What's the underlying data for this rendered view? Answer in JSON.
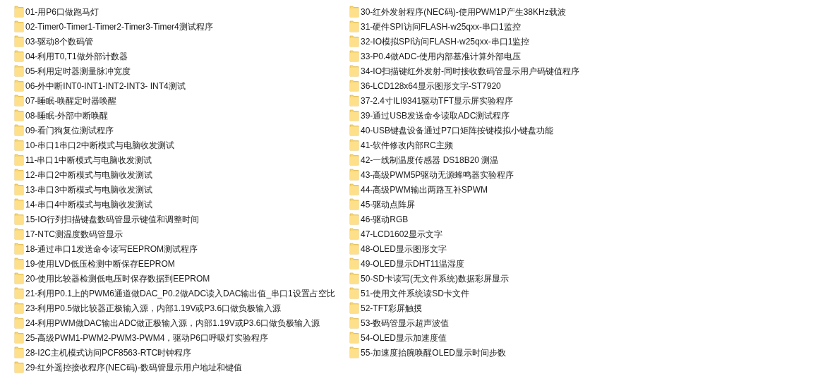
{
  "columns": [
    {
      "items": [
        {
          "name": "01-用P6口做跑马灯"
        },
        {
          "name": "02-Timer0-Timer1-Timer2-Timer3-Timer4测试程序"
        },
        {
          "name": "03-驱动8个数码管"
        },
        {
          "name": "04-利用T0,T1做外部计数器"
        },
        {
          "name": "05-利用定时器测量脉冲宽度"
        },
        {
          "name": "06-外中断INT0-INT1-INT2-INT3- INT4测试"
        },
        {
          "name": "07-睡眠-唤醒定时器唤醒"
        },
        {
          "name": "08-睡眠-外部中断唤醒"
        },
        {
          "name": "09-看门狗复位测试程序"
        },
        {
          "name": "10-串口1串口2中断模式与电脑收发测试"
        },
        {
          "name": "11-串口1中断模式与电脑收发测试"
        },
        {
          "name": "12-串口2中断模式与电脑收发测试"
        },
        {
          "name": "13-串口3中断模式与电脑收发测试"
        },
        {
          "name": "14-串口4中断模式与电脑收发测试"
        },
        {
          "name": "15-IO行列扫描键盘数码管显示键值和调整时间"
        },
        {
          "name": "17-NTC测温度数码管显示"
        },
        {
          "name": "18-通过串口1发送命令读写EEPROM测试程序"
        },
        {
          "name": "19-使用LVD低压检测中断保存EEPROM"
        },
        {
          "name": "20-使用比较器检测低电压时保存数据到EEPROM"
        },
        {
          "name": "21-利用P0.1上的PWM6通道做DAC_P0.2做ADC读入DAC输出值_串口1设置占空比"
        },
        {
          "name": "23-利用P0.5做比较器正极输入源，内部1.19V或P3.6口做负极输入源"
        },
        {
          "name": "24-利用PWM做DAC输出ADC做正极输入源，内部1.19V或P3.6口做负极输入源"
        },
        {
          "name": "25-高级PWM1-PWM2-PWM3-PWM4，驱动P6口呼吸灯实验程序"
        },
        {
          "name": "28-I2C主机模式访问PCF8563-RTC时钟程序"
        },
        {
          "name": "29-红外遥控接收程序(NEC码)-数码管显示用户地址和键值"
        }
      ]
    },
    {
      "items": [
        {
          "name": "30-红外发射程序(NEC码)-使用PWM1P产生38KHz载波"
        },
        {
          "name": "31-硬件SPI访问FLASH-w25qxx-串口1监控"
        },
        {
          "name": "32-IO模拟SPI访问FLASH-w25qxx-串口1监控"
        },
        {
          "name": "33-P0.4做ADC-使用内部基准计算外部电压"
        },
        {
          "name": "34-IO扫描键红外发射-同时接收数码管显示用户码键值程序"
        },
        {
          "name": "36-LCD128x64显示图形文字-ST7920"
        },
        {
          "name": "37-2.4寸ILI9341驱动TFT显示屏实验程序"
        },
        {
          "name": "39-通过USB发送命令读取ADC测试程序"
        },
        {
          "name": "40-USB键盘设备通过P7口矩阵按键模拟小键盘功能"
        },
        {
          "name": "41-软件修改内部RC主频"
        },
        {
          "name": "42-一线制温度传感器 DS18B20 测温"
        },
        {
          "name": "43-高级PWM5P驱动无源蜂鸣器实验程序"
        },
        {
          "name": "44-高级PWM输出两路互补SPWM"
        },
        {
          "name": "45-驱动点阵屏"
        },
        {
          "name": "46-驱动RGB"
        },
        {
          "name": "47-LCD1602显示文字"
        },
        {
          "name": "48-OLED显示图形文字"
        },
        {
          "name": "49-OLED显示DHT11温湿度"
        },
        {
          "name": "50-SD卡读写(无文件系统)数据彩屏显示"
        },
        {
          "name": "51-使用文件系统读SD卡文件"
        },
        {
          "name": "52-TFT彩屏触摸"
        },
        {
          "name": "53-数码管显示超声波值"
        },
        {
          "name": "54-OLED显示加速度值"
        },
        {
          "name": "55-加速度抬腕唤醒OLED显示时间步数"
        }
      ]
    }
  ]
}
